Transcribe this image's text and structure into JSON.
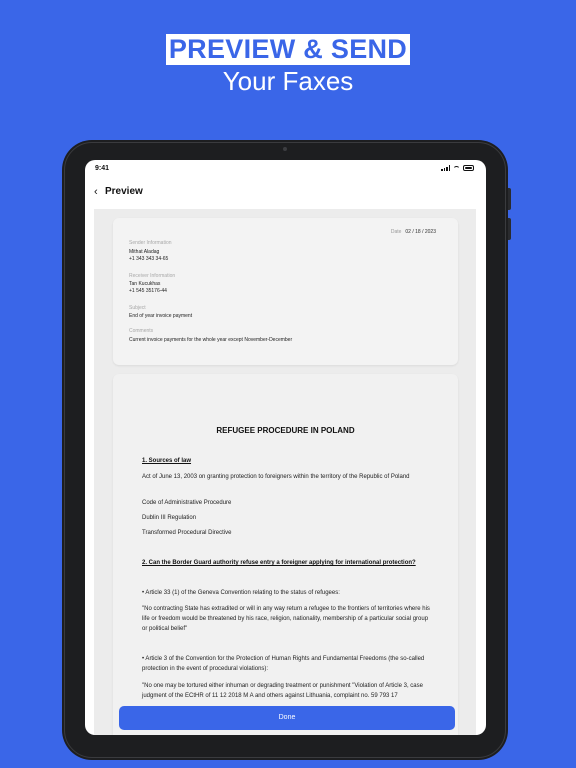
{
  "hero": {
    "line1": "PREVIEW & SEND",
    "line2": "Your Faxes"
  },
  "status": {
    "time": "9:41"
  },
  "nav": {
    "title": "Preview"
  },
  "info": {
    "date_label": "Date",
    "date_value": "02 / 18 / 2023",
    "sender_label": "Sender Information",
    "sender_name": "Mithat Aladag",
    "sender_phone": "+1 343 343 34-65",
    "receiver_label": "Receiver Information",
    "receiver_name": "Tan Kucukhas",
    "receiver_phone": "+1 545 35176-44",
    "subject_label": "Subject",
    "subject_value": "End of year invoice payment",
    "comments_label": "Comments",
    "comments_value": "Current invoice payments for the whole year except November-December"
  },
  "document": {
    "title": "REFUGEE PROCEDURE IN POLAND",
    "s1_heading": "1. Sources of law",
    "s1_p1": "Act of June 13, 2003 on granting protection to foreigners within the territory of the Republic of Poland",
    "s1_p2": "Code of Administrative Procedure",
    "s1_p3": "Dublin III Regulation",
    "s1_p4": "Transformed Procedural Directive",
    "s2_heading": "2. Can the Border Guard authority refuse entry a foreigner applying for international protection?",
    "s2_p1": "• Article 33 (1) of the Geneva Convention relating to the status of refugees:",
    "s2_p2": "\"No contracting State has extradited or will in any way return a refugee to the frontiers of territories where his life or freedom would be threatened by his race, religion, nationality, membership of a particular social group or political belief\"",
    "s2_p3": "• Article 3 of the Convention for the Protection of Human Rights and Fundamental Freedoms (the so-called protection in the event of procedural violations):",
    "s2_p4": "\"No one may be tortured either inhuman or degrading treatment or punishment \"Violation of Article 3, case judgment of the ECtHR of 11 12 2018 M A and others against Lithuania, complaint no. 59 793 17"
  },
  "done_label": "Done"
}
